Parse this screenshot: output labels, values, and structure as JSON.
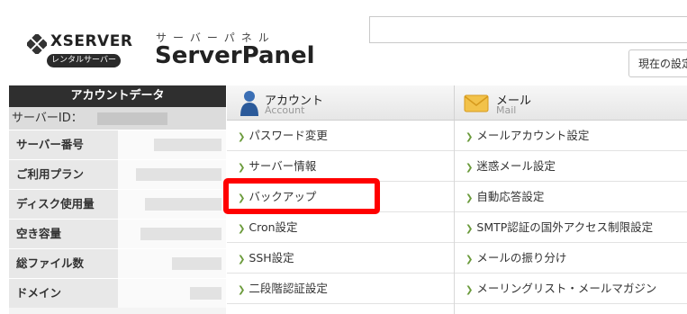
{
  "header": {
    "logo_text": "XSERVER",
    "logo_badge": "レンタルサーバー",
    "panel_kana": "サーバーパネル",
    "panel_title": "ServerPanel",
    "settings_label": "現在の設定"
  },
  "sidebar": {
    "title": "アカウントデータ",
    "server_id_label": "サーバーID：",
    "rows": [
      {
        "label": "サーバー番号"
      },
      {
        "label": "ご利用プラン"
      },
      {
        "label": "ディスク使用量"
      },
      {
        "label": "空き容量"
      },
      {
        "label": "総ファイル数"
      },
      {
        "label": "ドメイン"
      }
    ]
  },
  "menu": {
    "account": {
      "title": "アカウント",
      "subtitle": "Account",
      "items": [
        "パスワード変更",
        "サーバー情報",
        "バックアップ",
        "Cron設定",
        "SSH設定",
        "二段階認証設定"
      ]
    },
    "mail": {
      "title": "メール",
      "subtitle": "Mail",
      "items": [
        "メールアカウント設定",
        "迷惑メール設定",
        "自動応答設定",
        "SMTP認証の国外アクセス制限設定",
        "メールの振り分け",
        "メーリングリスト・メールマガジン"
      ]
    }
  },
  "colors": {
    "highlight": "#ff0000",
    "sidebar_header": "#2f2f2f",
    "arrow": "#6a9a3a"
  }
}
